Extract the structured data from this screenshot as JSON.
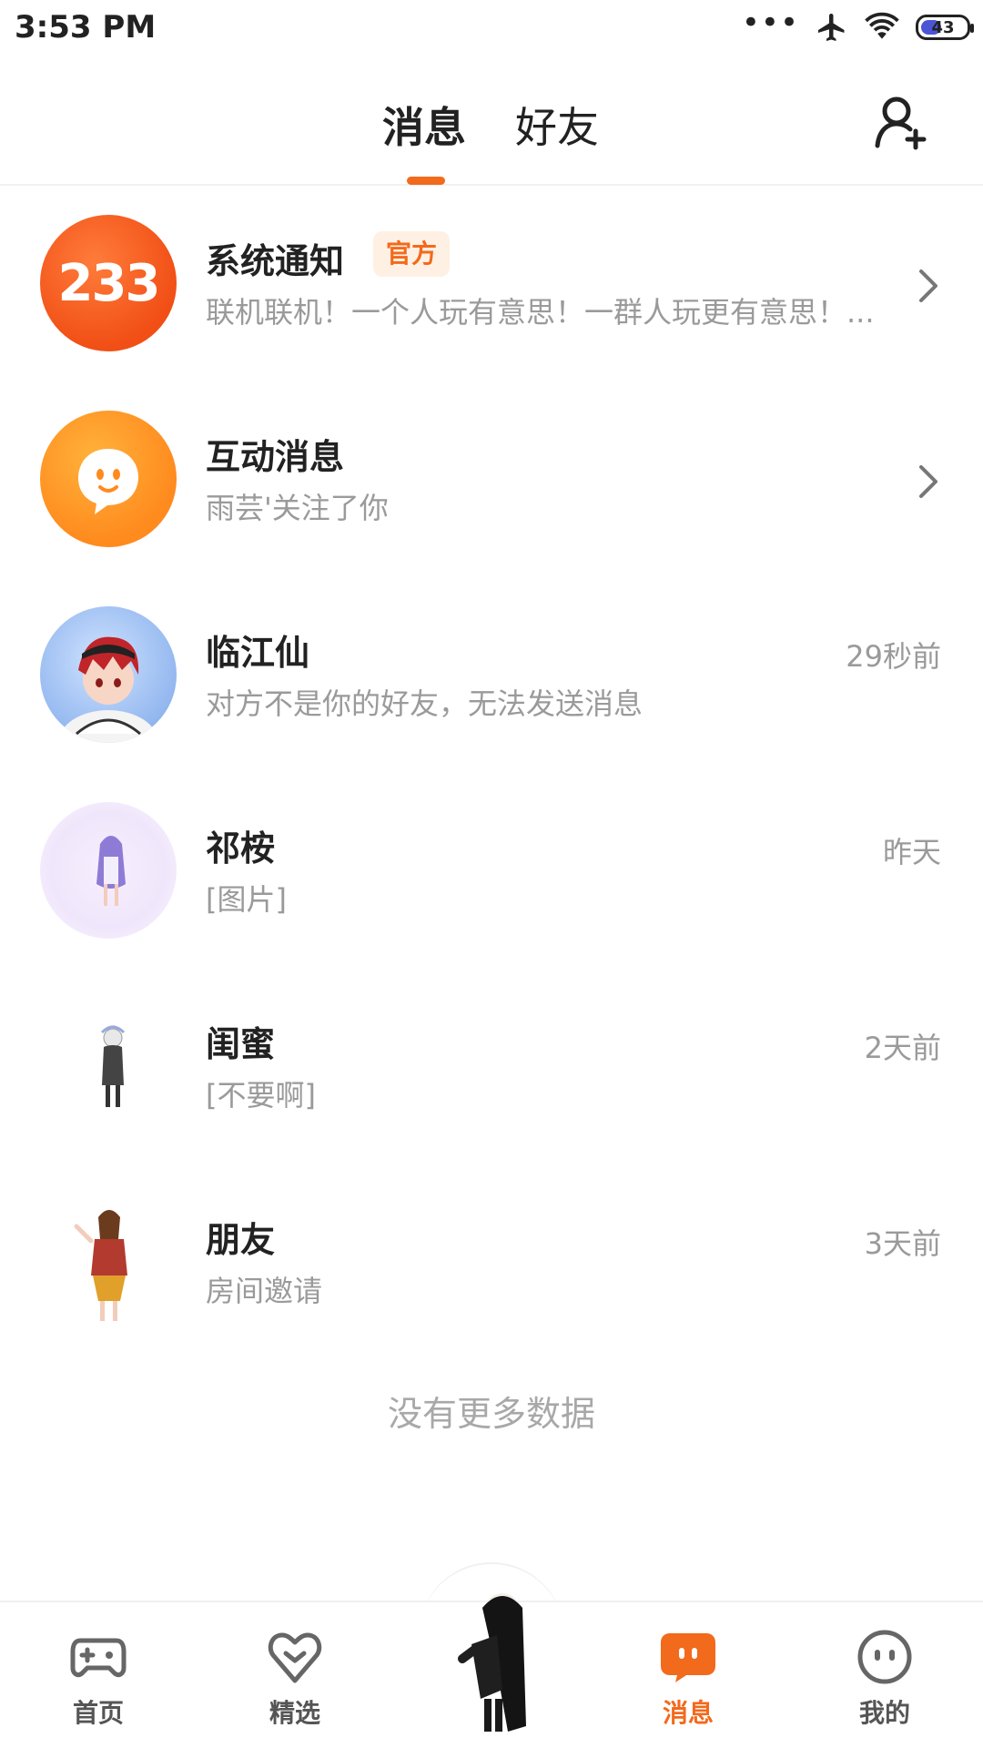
{
  "status_bar": {
    "time": "3:53 PM",
    "dots": "•••",
    "battery": "43"
  },
  "header": {
    "tabs": [
      {
        "label": "消息",
        "active": true
      },
      {
        "label": "好友",
        "active": false
      }
    ],
    "add_friend_icon": "add-user-icon",
    "accent_color": "#f26a1b"
  },
  "messages": [
    {
      "name": "系统通知",
      "badge": "官方",
      "preview": "联机联机！一个人玩有意思！一群人玩更有意思！...",
      "time": "",
      "avatar_text": "233",
      "has_chevron": true
    },
    {
      "name": "互动消息",
      "badge": "",
      "preview": "雨芸'关注了你",
      "time": "",
      "avatar_icon": "chat-smile-icon",
      "has_chevron": true
    },
    {
      "name": "临江仙",
      "badge": "",
      "preview": "对方不是你的好友，无法发送消息",
      "time": "29秒前"
    },
    {
      "name": "祁桉",
      "badge": "",
      "preview": "[图片]",
      "time": "昨天"
    },
    {
      "name": "闺蜜",
      "badge": "",
      "preview": "[不要啊]",
      "time": "2天前"
    },
    {
      "name": "朋友",
      "badge": "",
      "preview": "房间邀请",
      "time": "3天前"
    }
  ],
  "end_text": "没有更多数据",
  "bottom_nav": [
    {
      "label": "首页",
      "icon": "gamepad-icon",
      "active": false
    },
    {
      "label": "精选",
      "icon": "heart-icon",
      "active": false
    },
    {
      "label": "",
      "icon": "avatar-character",
      "active": false
    },
    {
      "label": "消息",
      "icon": "message-icon",
      "active": true
    },
    {
      "label": "我的",
      "icon": "profile-face-icon",
      "active": false
    }
  ]
}
